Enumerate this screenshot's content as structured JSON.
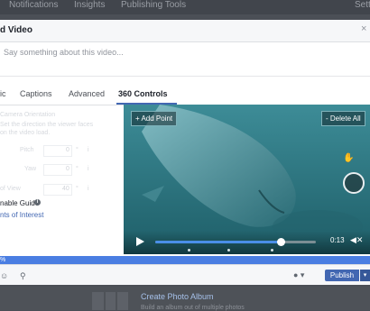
{
  "background": {
    "nav_items": [
      "Notifications",
      "Insights",
      "Publishing Tools",
      "Sett"
    ],
    "album_title": "Create Photo Album",
    "album_desc": "Build an album out of multiple photos"
  },
  "dialog": {
    "title": "d Video",
    "close_glyph": "×",
    "composer_placeholder": "Say something about this video..."
  },
  "tabs": [
    {
      "label": "ic",
      "active": false
    },
    {
      "label": "Captions",
      "active": false
    },
    {
      "label": "Advanced",
      "active": false
    },
    {
      "label": "360 Controls",
      "active": true
    }
  ],
  "settings": {
    "section_title": "Camera Orientation",
    "section_desc_1": "Set the direction the viewer faces",
    "section_desc_2": "on the video load.",
    "pitch": {
      "label": "Pitch",
      "value": "0",
      "unit": "°"
    },
    "yaw": {
      "label": "Yaw",
      "value": "0",
      "unit": "°"
    },
    "field_of_view": {
      "label": "of View",
      "value": "40",
      "unit": "°"
    },
    "info_glyph": "i",
    "enable_guide_label": "nable Guide",
    "points_of_interest_link": "nts of Interest"
  },
  "video": {
    "add_point_label": "+ Add Point",
    "delete_all_label": "- Delete All",
    "time": "0:13",
    "mute_glyph": "◀✕",
    "progress": 0.78,
    "poi_dots": [
      0.2,
      0.45,
      0.72
    ]
  },
  "upload": {
    "percent_label": "%"
  },
  "footer": {
    "audience_glyph": "● ▾",
    "publish_label": "Publish",
    "caret": "▾"
  },
  "colors": {
    "accent": "#4267b2",
    "upload_bar": "#4a7ee2",
    "video_water": "#2f7b86"
  }
}
